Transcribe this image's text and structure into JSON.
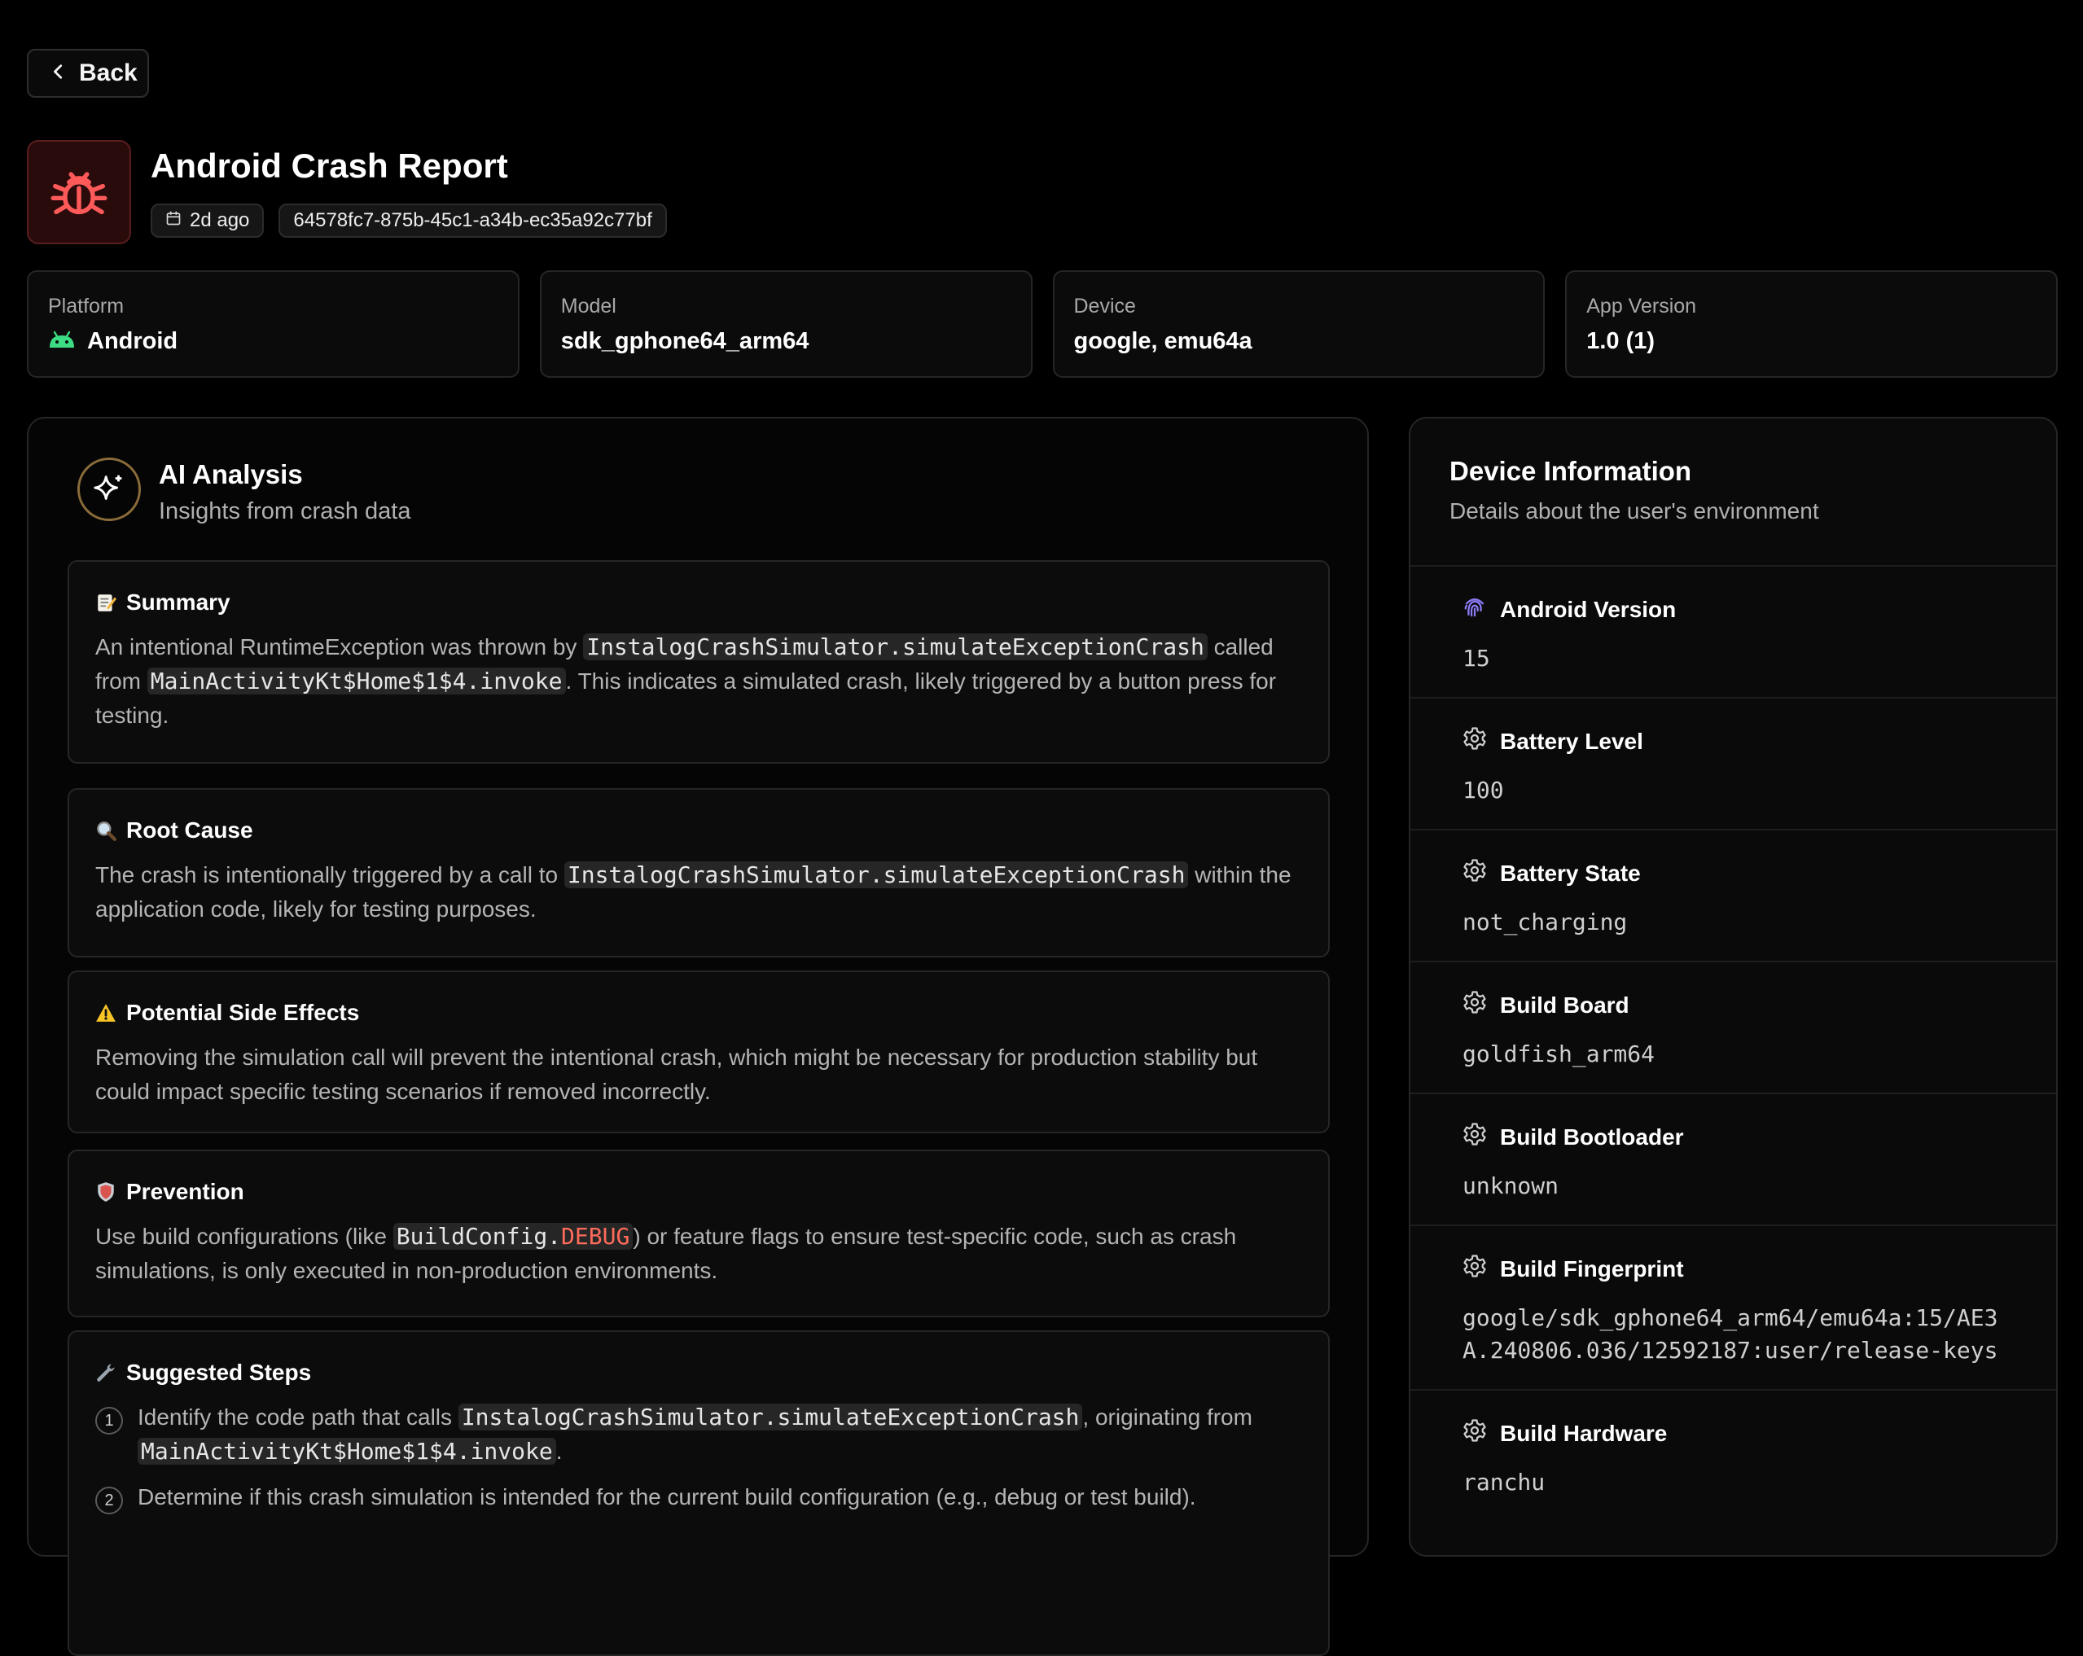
{
  "nav": {
    "back_label": "Back",
    "back_icon": "chevron-left-icon"
  },
  "header": {
    "title": "Android Crash Report",
    "app_icon": "bug-icon",
    "time_ago": "2d ago",
    "report_id": "64578fc7-875b-45c1-a34b-ec35a92c77bf",
    "accent_color": "#ff5a5a"
  },
  "stats": {
    "platform": {
      "label": "Platform",
      "value": "Android",
      "icon": "android-icon",
      "icon_color": "#3ddc84"
    },
    "model": {
      "label": "Model",
      "value": "sdk_gphone64_arm64"
    },
    "device": {
      "label": "Device",
      "value": "google, emu64a"
    },
    "app_version": {
      "label": "App Version",
      "value": "1.0 (1)"
    }
  },
  "ai": {
    "title": "AI Analysis",
    "subtitle": "Insights from crash data",
    "summary": {
      "title": "Summary",
      "icon": "memo-icon",
      "t1": "An intentional RuntimeException was thrown by ",
      "c1": "InstalogCrashSimulator.simulateExceptionCrash",
      "t2": " called from ",
      "c2": "MainActivityKt$Home$1$4.invoke",
      "t3": ". This indicates a simulated crash, likely triggered by a button press for testing."
    },
    "root_cause": {
      "title": "Root Cause",
      "icon": "magnifier-icon",
      "t1": "The crash is intentionally triggered by a call to ",
      "c1": "InstalogCrashSimulator.simulateExceptionCrash",
      "t2": " within the application code, likely for testing purposes."
    },
    "side_effects": {
      "title": "Potential Side Effects",
      "icon": "warning-icon",
      "text": "Removing the simulation call will prevent the intentional crash, which might be necessary for production stability but could impact specific testing scenarios if removed incorrectly."
    },
    "prevention": {
      "title": "Prevention",
      "icon": "shield-icon",
      "t1": "Use build configurations (like ",
      "c1a": "BuildConfig.",
      "c1b": "DEBUG",
      "t2": ") or feature flags to ensure test-specific code, such as crash simulations, is only executed in non-production environments."
    },
    "steps": {
      "title": "Suggested Steps",
      "icon": "wrench-icon",
      "items": [
        {
          "num": "1",
          "t1": "Identify the code path that calls ",
          "c1": "InstalogCrashSimulator.simulateExceptionCrash",
          "t2": ", originating from ",
          "c2": "MainActivityKt$Home$1$4.invoke",
          "t3": "."
        },
        {
          "num": "2",
          "t1": "Determine if this crash simulation is intended for the current build configuration (e.g., debug or test build)."
        }
      ]
    }
  },
  "device_info": {
    "title": "Device Information",
    "subtitle": "Details about the user's environment",
    "items": [
      {
        "label": "Android Version",
        "value": "15",
        "icon": "fingerprint-icon"
      },
      {
        "label": "Battery Level",
        "value": "100",
        "icon": "gear-icon"
      },
      {
        "label": "Battery State",
        "value": "not_charging",
        "icon": "gear-icon"
      },
      {
        "label": "Build Board",
        "value": "goldfish_arm64",
        "icon": "gear-icon"
      },
      {
        "label": "Build Bootloader",
        "value": "unknown",
        "icon": "gear-icon"
      },
      {
        "label": "Build Fingerprint",
        "value": "google/sdk_gphone64_arm64/emu64a:15/AE3A.240806.036/12592187:user/release-keys",
        "icon": "gear-icon"
      },
      {
        "label": "Build Hardware",
        "value": "ranchu",
        "icon": "gear-icon"
      }
    ]
  }
}
